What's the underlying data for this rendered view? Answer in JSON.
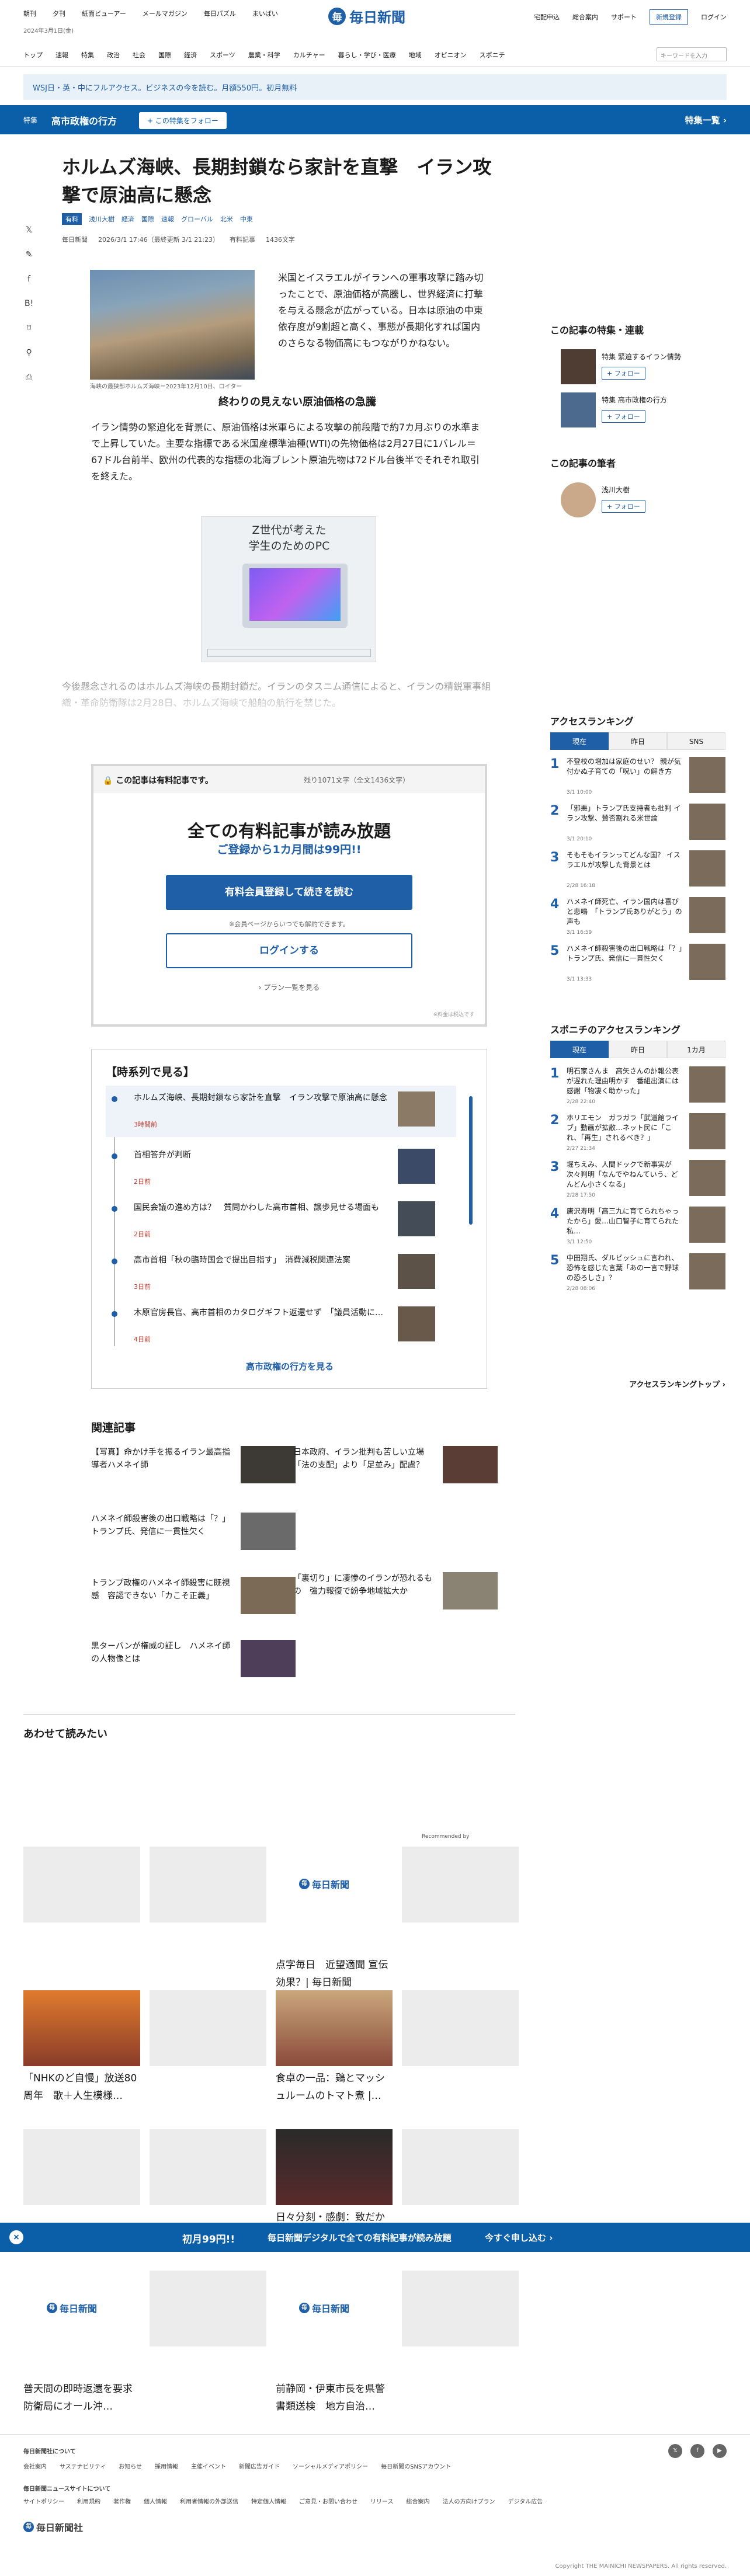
{
  "header": {
    "services": [
      "朝刊",
      "夕刊",
      "紙面ビューアー",
      "メールマガジン",
      "毎日パズル",
      "まいばい"
    ],
    "date": "2024年3月1日(金)",
    "logo_mark": "毎",
    "logo_name": "毎日新聞",
    "util": [
      "宅配申込",
      "総合案内",
      "サポート"
    ],
    "register": "新規登録",
    "login": "ログイン"
  },
  "nav": {
    "items": [
      "トップ",
      "速報",
      "特集",
      "政治",
      "社会",
      "国際",
      "経済",
      "スポーツ",
      "農業・科学",
      "カルチャー",
      "暮らし・学び・医療",
      "地域",
      "オピニオン",
      "スポニチ"
    ],
    "search_placeholder": "キーワードを入力"
  },
  "wsj": "WSJ日・英・中にフルアクセス。ビジネスの今を読む。月額550円。初月無料",
  "feature": {
    "tag": "特集",
    "title": "高市政権の行方",
    "follow": "+ この特集をフォロー",
    "list": "特集一覧 ›"
  },
  "article": {
    "title": "ホルムズ海峡、長期封鎖なら家計を直撃　イラン攻撃で原油高に懸念",
    "tags": [
      "有料",
      "浅川大樹",
      "経済",
      "国際",
      "速報",
      "グローバル",
      "北米",
      "中東"
    ],
    "source": "毎日新聞",
    "time": "2026/3/1 17:46（最終更新 3/1 21:23）",
    "paid": "有料記事",
    "chars": "1436文字",
    "caption": "海峡の最狭部ホルムズ海峡＝2023年12月10日、ロイター",
    "p1": "米国とイスラエルがイランへの軍事攻撃に踏み切ったことで、原油価格が高騰し、世界経済に打撃を与える懸念が広がっている。日本は原油の中東依存度が9割超と高く、事態が長期化すれば国内のさらなる物価高にもつながりかねない。",
    "h2": "終わりの見えない原油価格の急騰",
    "p2": "イラン情勢の緊迫化を背景に、原油価格は米軍らによる攻撃の前段階で約7カ月ぶりの水準まで上昇していた。主要な指標である米国産標準油種(WTI)の先物価格は2月27日に1バレル＝67ドル台前半、欧州の代表的な指標の北海ブレント原油先物は72ドル台後半でそれぞれ取引を終えた。",
    "p3": "今後懸念されるのはホルムズ海峡の長期封鎖だ。イランのタスニム通信によると、イランの精鋭軍事組織・革命防衛隊は2月28日、ホルムズ海峡で船舶の航行を禁じた。"
  },
  "ad": {
    "text": "Z世代が考えた\n学生のためのPC"
  },
  "paywall": {
    "header": "この記事は有料記事です。",
    "left": "残り1071文字（全文1436文字）",
    "big": "全ての有料記事が読み放題",
    "sub": "ご登録から1カ月間は99円!!",
    "cta": "有料会員登録して続きを読む",
    "note": "※会員ページからいつでも解約できます。",
    "login": "ログインする",
    "plan": "› プラン一覧を見る",
    "foot": "※料金は税込です"
  },
  "timeline": {
    "title": "【時系列で見る】",
    "items": [
      {
        "text": "ホルムズ海峡、長期封鎖なら家計を直撃　イラン攻撃で原油高に懸念",
        "date": "3時間前"
      },
      {
        "text": "首相答弁が判断",
        "date": "2日前"
      },
      {
        "text": "国民会議の進め方は？　質問かわした高市首相、譲歩見せる場面も",
        "date": "2日前"
      },
      {
        "text": "高市首相「秋の臨時国会で提出目指す」　消費減税関連法案",
        "date": "3日前"
      },
      {
        "text": "木原官房長官、高市首相のカタログギフト返還せず　「議員活動に…",
        "date": "4日前"
      }
    ],
    "more": "高市政権の行方を見る"
  },
  "related": {
    "title": "関連記事",
    "items": [
      {
        "text": "【写真】命かけ手を振るイラン最高指導者ハメネイ師"
      },
      {
        "text": "日本政府、イラン批判も苦しい立場　「法の支配」より「足並み」配慮？"
      },
      {
        "text": "ハメネイ師殺害後の出口戦略は「？」　トランプ氏、発信に一貫性欠く"
      },
      {
        "text": "「裏切り」に凄惨のイランが恐れるもの　強力報復で紛争地域拡大か"
      },
      {
        "text": "トランプ政権のハメネイ師殺害に既視感　容認できない「カこそ正義」"
      },
      {
        "text": "黒ターバンが権威の証し　ハメネイ師の人物像とは"
      }
    ]
  },
  "recommend": {
    "title": "あわせて読みたい",
    "by": "Recommended by",
    "cards": [
      "",
      "",
      "点字毎日　近望適聞 宣伝効果？| 毎日新聞",
      "",
      "「NHKのど自慢」放送80周年　歌＋人生模様…",
      "",
      "食卓の一品：鶏とマッシュルームのトマト煮 |…",
      "",
      "",
      "",
      "日々分刻・感劇：致だから…",
      "",
      "普天間の即時返還を要求　防衛局にオール沖…",
      "",
      "前静岡・伊東市長を県警書類送検　地方自治…",
      ""
    ]
  },
  "sidebar": {
    "features_title": "この記事の特集・連載",
    "features": [
      {
        "name": "特集 緊迫するイラン情勢"
      },
      {
        "name": "特集 高市政権の行方"
      }
    ],
    "follow": "+ フォロー",
    "author_title": "この記事の筆者",
    "author": "浅川大樹",
    "ranking_title": "アクセスランキング",
    "tabs": [
      "現在",
      "昨日",
      "SNS"
    ],
    "ranking": [
      {
        "n": "1",
        "text": "不登校の増加は家庭のせい？ 親が気付かぬ子育ての「呪い」の解き方",
        "time": "3/1 10:00"
      },
      {
        "n": "2",
        "text": "「邪悪」トランプ氏支持者も批判 イラン攻撃、賛否割れる米世論",
        "time": "3/1 20:10"
      },
      {
        "n": "3",
        "text": "そもそもイランってどんな国？ イスラエルが攻撃した背景とは",
        "time": "2/28 16:18"
      },
      {
        "n": "4",
        "text": "ハメネイ師死亡、イラン国内は喜びと悲鳴　「トランプ氏ありがとう」の声も",
        "time": "3/1 16:59"
      },
      {
        "n": "5",
        "text": "ハメネイ師殺害後の出口戦略は「？」　トランプ氏、発信に一貫性欠く",
        "time": "3/1 13:33"
      }
    ],
    "sponichi_title": "スポニチのアクセスランキング",
    "sponichi_tabs": [
      "現在",
      "昨日",
      "1カ月"
    ],
    "sponichi": [
      {
        "n": "1",
        "text": "明石家さんま　高矢さんの訃報公表が遅れた理由明かす　番組出演には感謝「物凄く助かった」",
        "time": "2/28 22:40"
      },
      {
        "n": "2",
        "text": "ホリエモン　ガラガラ「武道館ライブ」動画が拡散…ネット民に「これ、「再生」されるべき？」",
        "time": "2/27 21:34"
      },
      {
        "n": "3",
        "text": "堀ちえみ、人間ドックで新事実が次々判明「なんでやねんていう、どんどん小さくなる」",
        "time": "2/28 17:50"
      },
      {
        "n": "4",
        "text": "唐沢寿明「高三九に育てられちゃったから」愛…山口智子に育てられた私…",
        "time": "3/1 12:50"
      },
      {
        "n": "5",
        "text": "中田翔氏、ダルビッシュに言われ、恐怖を感じた言葉「あの一言で野球の恐ろしさ」？",
        "time": "2/28 08:06"
      }
    ],
    "ranking_more": "アクセスランキングトップ ›"
  },
  "promo": {
    "close": "×",
    "p1": "初月99円!!",
    "p2": "毎日新聞デジタルで全ての有料記事が読み放題",
    "p3": "今すぐ申し込む ›"
  },
  "footer": {
    "about": "毎日新聞社について",
    "links1": [
      "会社案内",
      "サステナビリティ",
      "お知らせ",
      "採用情報",
      "主催イベント",
      "新聞広告ガイド",
      "ソーシャルメディアポリシー",
      "毎日新聞のSNSアカウント"
    ],
    "site": "毎日新聞ニュースサイトについて",
    "links2": [
      "サイトポリシー",
      "利用規約",
      "著作権",
      "個人情報",
      "利用者情報の外部送信",
      "特定個人情報",
      "ご意見・お問い合わせ",
      "リリース",
      "総合案内",
      "法人の方向けプラン",
      "デジタル広告"
    ],
    "copy": "Copyright THE MAINICHI NEWSPAPERS. All rights reserved.",
    "logo": "毎日新聞社"
  }
}
